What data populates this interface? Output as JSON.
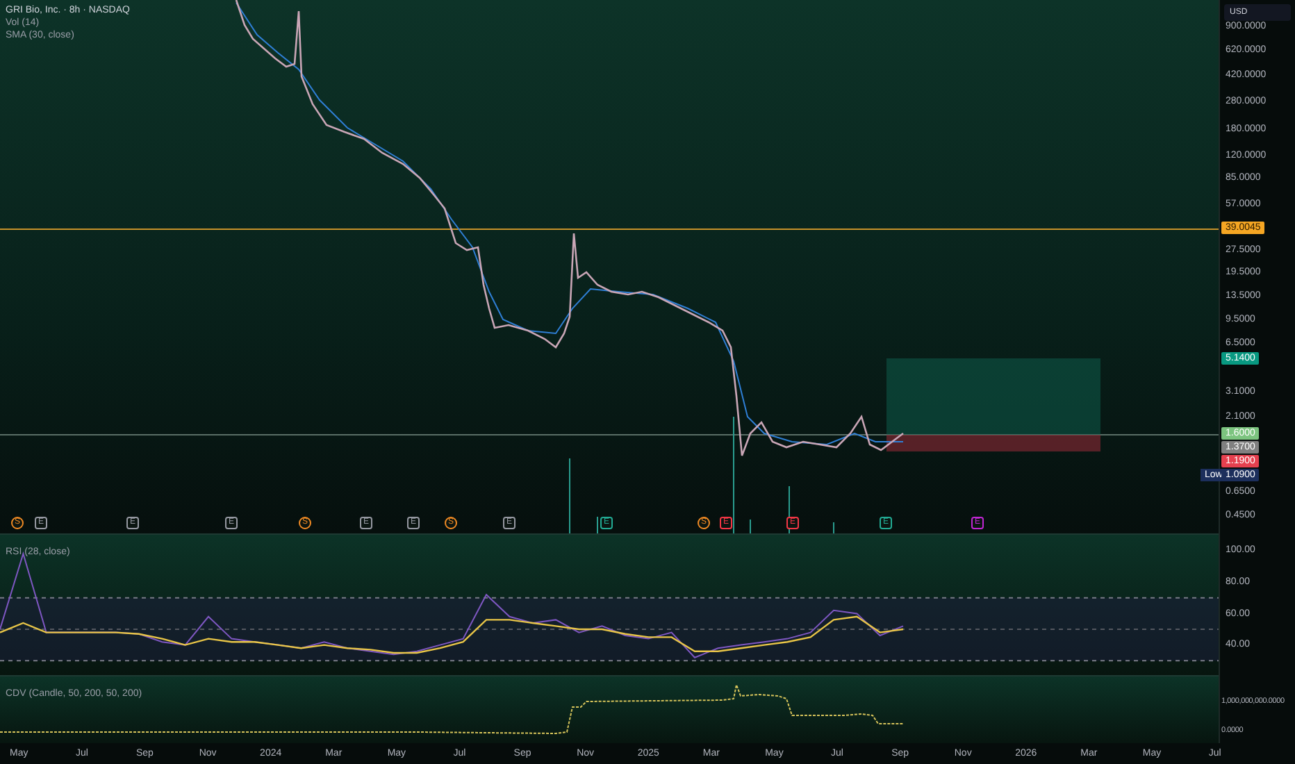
{
  "legend": {
    "title": "GRI Bio, Inc. · 8h · NASDAQ",
    "indicators": [
      "Vol (14)",
      "SMA (30, close)"
    ]
  },
  "currency_button": "USD",
  "price_axis": {
    "ticks": [
      "900.0000",
      "620.0000",
      "420.0000",
      "280.0000",
      "180.0000",
      "120.0000",
      "85.0000",
      "57.0000",
      "27.5000",
      "19.5000",
      "13.5000",
      "9.5000",
      "6.5000",
      "3.1000",
      "2.1000",
      "0.6500",
      "0.4500"
    ]
  },
  "price_badges": [
    {
      "kind": "alert",
      "label": "39.0045",
      "color": "#f5a623"
    },
    {
      "kind": "target",
      "label": "5.1400",
      "color": "#089981"
    },
    {
      "kind": "entry",
      "label": "1.6000",
      "color": "#7cc47f"
    },
    {
      "kind": "last",
      "label": "1.3700",
      "color": "#808080"
    },
    {
      "kind": "stop",
      "label": "1.1900",
      "color": "#e5404f"
    },
    {
      "kind": "low",
      "caption": "Low",
      "label": "1.0900",
      "color": "#1c2f5c"
    }
  ],
  "events": [
    {
      "kind": "dividend",
      "label": "S",
      "color": "#f08a24"
    },
    {
      "kind": "earnings",
      "label": "E",
      "color": "#9598a1"
    },
    {
      "kind": "earnings",
      "label": "E",
      "color": "#9598a1"
    },
    {
      "kind": "earnings",
      "label": "E",
      "color": "#9598a1"
    },
    {
      "kind": "dividend",
      "label": "S",
      "color": "#f08a24"
    },
    {
      "kind": "earnings",
      "label": "E",
      "color": "#9598a1"
    },
    {
      "kind": "earnings",
      "label": "E",
      "color": "#9598a1"
    },
    {
      "kind": "dividend",
      "label": "S",
      "color": "#f08a24"
    },
    {
      "kind": "earnings",
      "label": "E",
      "color": "#9598a1"
    },
    {
      "kind": "earnings",
      "label": "E",
      "color": "#22ab94"
    },
    {
      "kind": "dividend",
      "label": "S",
      "color": "#f08a24"
    },
    {
      "kind": "earnings",
      "label": "E",
      "color": "#f23645"
    },
    {
      "kind": "earnings",
      "label": "E",
      "color": "#f23645"
    },
    {
      "kind": "earnings",
      "label": "E",
      "color": "#22ab94"
    },
    {
      "kind": "earnings",
      "label": "E",
      "color": "#c026d3"
    }
  ],
  "rsi": {
    "title": "RSI (28, close)",
    "ticks": [
      "100.00",
      "80.00",
      "60.00",
      "40.00"
    ]
  },
  "cdv": {
    "title": "CDV (Candle, 50, 200, 50, 200)",
    "ticks": [
      "1,000,000,000.0000",
      "0.0000"
    ]
  },
  "time_axis": [
    "May",
    "Jul",
    "Sep",
    "Nov",
    "2024",
    "Mar",
    "May",
    "Jul",
    "Sep",
    "Nov",
    "2025",
    "Mar",
    "May",
    "Jul",
    "Sep",
    "Nov",
    "2026",
    "Mar",
    "May",
    "Jul"
  ]
}
